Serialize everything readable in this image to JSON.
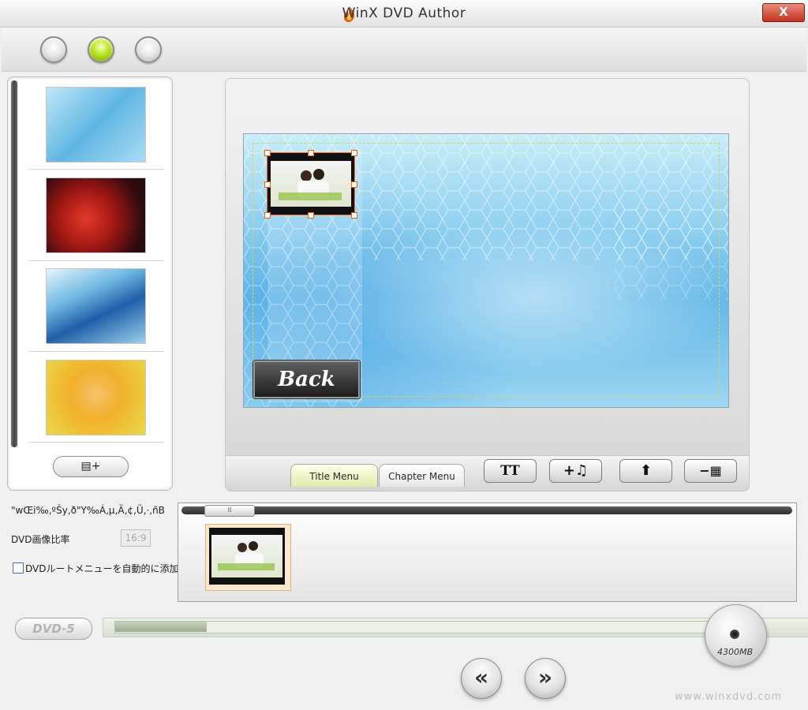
{
  "window": {
    "title": "WinX DVD Author",
    "close_label": "X"
  },
  "steps": [
    "step-1",
    "step-2",
    "step-3"
  ],
  "background_list": {
    "items": [
      "blue-mosaic-thumbnail",
      "red-roses-thumbnail",
      "blue-waves-thumbnail",
      "yellow-flowers-thumbnail"
    ],
    "add_button_icon": "add-list-icon"
  },
  "preview": {
    "back_button_label": "Back"
  },
  "toolbar": {
    "tabs": {
      "title_menu": "Title Menu",
      "chapter_menu": "Chapter Menu"
    },
    "text_button": "TT",
    "music_button": "+♫",
    "up_button": "⬆",
    "subtitle_button": "−▦"
  },
  "options": {
    "garbled_line": "\"wŒi‰‚ºŠy‚ð\"Y‰Á‚µ‚Ä‚¢‚Ü‚·‚ñB",
    "aspect_label": "DVD画像比率",
    "aspect_value": "16:9",
    "auto_menu_label": "DVDルートメニューを自動的に添加する"
  },
  "titles": {
    "slider_grip": "II"
  },
  "disc": {
    "type": "DVD-5",
    "capacity": "4300MB",
    "used_fraction": 0.15
  },
  "nav": {
    "back": "«",
    "next": "»"
  },
  "brand": "www.winxdvd.com",
  "colors": {
    "accent_green": "#b7e21b",
    "selection_orange": "#ff6a1a"
  }
}
